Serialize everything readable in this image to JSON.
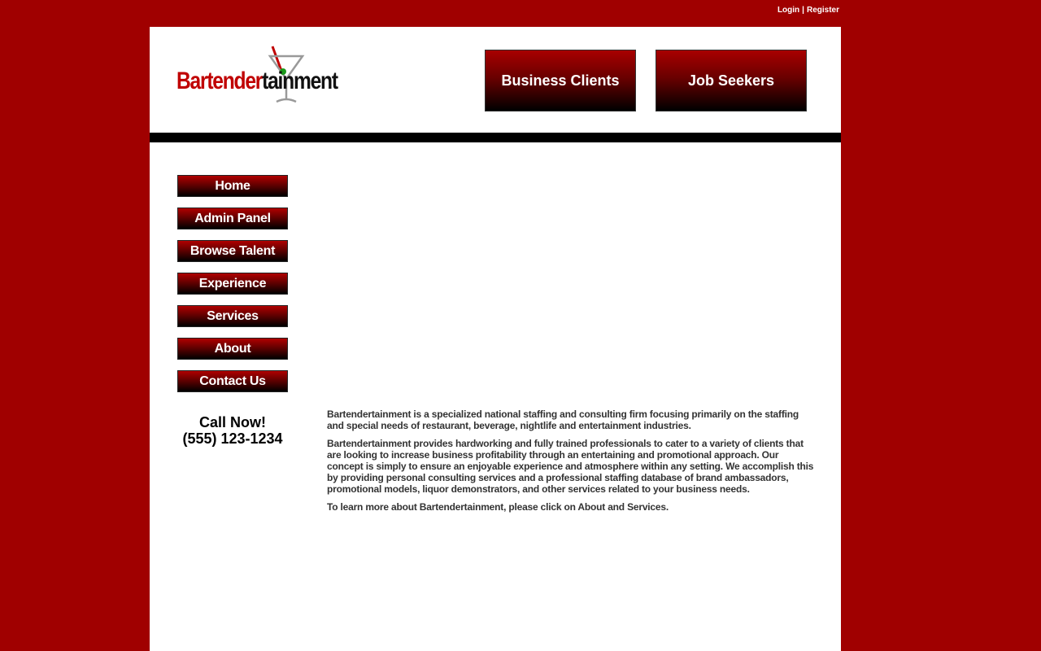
{
  "top_links": {
    "login": "Login",
    "separator": "|",
    "register": "Register"
  },
  "logo": {
    "part1": "Bartender",
    "part2": "tainment"
  },
  "header_buttons": {
    "business": "Business Clients",
    "jobseekers": "Job Seekers"
  },
  "nav": [
    {
      "label": "Home"
    },
    {
      "label": "Admin Panel"
    },
    {
      "label": "Browse Talent"
    },
    {
      "label": "Experience"
    },
    {
      "label": "Services"
    },
    {
      "label": "About"
    },
    {
      "label": "Contact Us"
    }
  ],
  "callnow": {
    "line1": "Call Now!",
    "line2": "(555) 123-1234"
  },
  "content": {
    "p1": "Bartendertainment is a specialized national staffing and consulting firm focusing primarily on the staffing and special needs of restaurant, beverage, nightlife and entertainment industries.",
    "p2": "Bartendertainment provides hardworking and fully trained professionals to cater to a variety of clients that are looking to increase business profitability through an entertaining and promotional approach. Our concept is simply to ensure an enjoyable experience and atmosphere within any setting. We accomplish this by providing personal consulting services and a professional staffing database of brand ambassadors, promotional models, liquor demonstrators, and other services related to your business needs.",
    "p3": "To learn more about Bartendertainment, please click on About and Services."
  },
  "colors": {
    "background": "#a00000",
    "accent": "#c00000"
  }
}
